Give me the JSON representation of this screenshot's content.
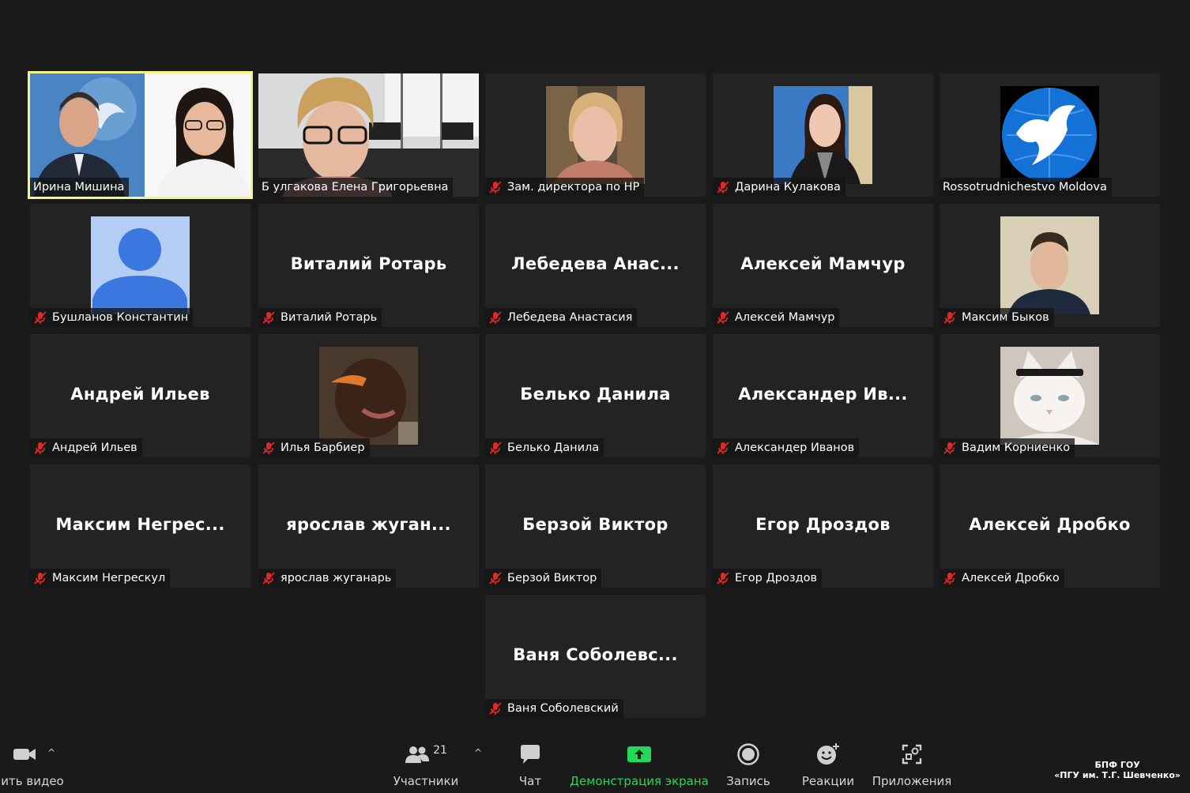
{
  "participants": [
    {
      "label": "Ирина Мишина",
      "big": "",
      "mic_muted": false,
      "active": true,
      "image": "two-people-video"
    },
    {
      "label": "Б улгакова Елена Григорьевна",
      "big": "",
      "mic_muted": false,
      "active": false,
      "image": "woman-classroom-video"
    },
    {
      "label": "Зам. директора по НР",
      "big": "",
      "mic_muted": true,
      "active": false,
      "image": "woman-portrait"
    },
    {
      "label": "Дарина Кулакова",
      "big": "",
      "mic_muted": true,
      "active": false,
      "image": "woman-blue-backdrop"
    },
    {
      "label": "Rossotrudnichestvo Moldova",
      "big": "",
      "mic_muted": false,
      "active": false,
      "image": "dove-globe-logo"
    },
    {
      "label": "Бушланов Константин",
      "big": "",
      "mic_muted": true,
      "active": false,
      "image": "default-avatar"
    },
    {
      "label": "Виталий Ротарь",
      "big": "Виталий Ротарь",
      "mic_muted": true,
      "active": false,
      "image": ""
    },
    {
      "label": "Лебедева Анастасия",
      "big": "Лебедева Анас...",
      "mic_muted": true,
      "active": false,
      "image": ""
    },
    {
      "label": "Алексей Мамчур",
      "big": "Алексей Мамчур",
      "mic_muted": true,
      "active": false,
      "image": ""
    },
    {
      "label": "Максим Быков",
      "big": "",
      "mic_muted": true,
      "active": false,
      "image": "young-man-portrait"
    },
    {
      "label": "Андрей Ильев",
      "big": "Андрей Ильев",
      "mic_muted": true,
      "active": false,
      "image": ""
    },
    {
      "label": "Илья Барбиер",
      "big": "",
      "mic_muted": true,
      "active": false,
      "image": "face-photo"
    },
    {
      "label": "Белько Данила",
      "big": "Белько Данила",
      "mic_muted": true,
      "active": false,
      "image": ""
    },
    {
      "label": "Александер Иванов",
      "big": "Александер Ив...",
      "mic_muted": true,
      "active": false,
      "image": ""
    },
    {
      "label": "Вадим Корниенко",
      "big": "",
      "mic_muted": true,
      "active": false,
      "image": "white-cat-photo"
    },
    {
      "label": "Максим Негрескул",
      "big": "Максим Негрес...",
      "mic_muted": true,
      "active": false,
      "image": ""
    },
    {
      "label": "ярослав жуганарь",
      "big": "ярослав жуган...",
      "mic_muted": true,
      "active": false,
      "image": ""
    },
    {
      "label": "Берзой Виктор",
      "big": "Берзой Виктор",
      "mic_muted": true,
      "active": false,
      "image": ""
    },
    {
      "label": "Егор Дроздов",
      "big": "Егор Дроздов",
      "mic_muted": true,
      "active": false,
      "image": ""
    },
    {
      "label": "Алексей Дробко",
      "big": "Алексей Дробко",
      "mic_muted": true,
      "active": false,
      "image": ""
    },
    {
      "label": "Ваня Соболевский",
      "big": "Ваня Соболевс...",
      "mic_muted": true,
      "active": false,
      "image": ""
    }
  ],
  "toolbar": {
    "video_label": "ить видео",
    "participants_label": "Участники",
    "participants_count": "21",
    "chat_label": "Чат",
    "share_label": "Демонстрация экрана",
    "record_label": "Запись",
    "reactions_label": "Реакции",
    "apps_label": "Приложения",
    "caret": "^"
  },
  "watermark": {
    "line1": "БПФ ГОУ",
    "line2": "«ПГУ им. Т.Г. Шевченко»"
  },
  "colors": {
    "share_accent": "#23d959",
    "active_border": "#f4f58a",
    "mute_red": "#e02828",
    "background": "#1a1a1a",
    "tile": "#232323"
  }
}
